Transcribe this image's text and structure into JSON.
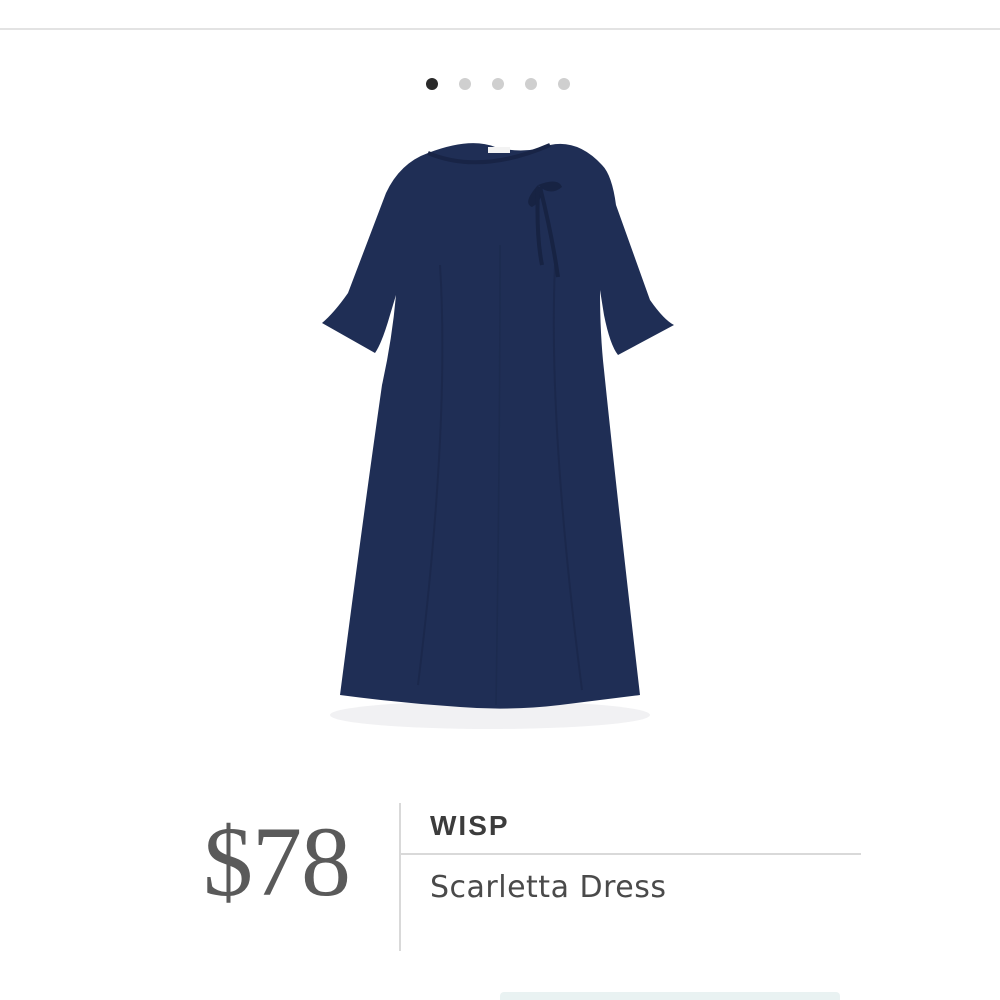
{
  "carousel": {
    "dot_count": 5,
    "active_index": 0
  },
  "product": {
    "image_label": "navy dress with neck tie",
    "price": "$78",
    "brand": "WISP",
    "name": "Scarletta Dress"
  },
  "colors": {
    "dress": "#1f2e55",
    "price_text": "#5a5a5a",
    "divider": "#d9d9d9"
  }
}
